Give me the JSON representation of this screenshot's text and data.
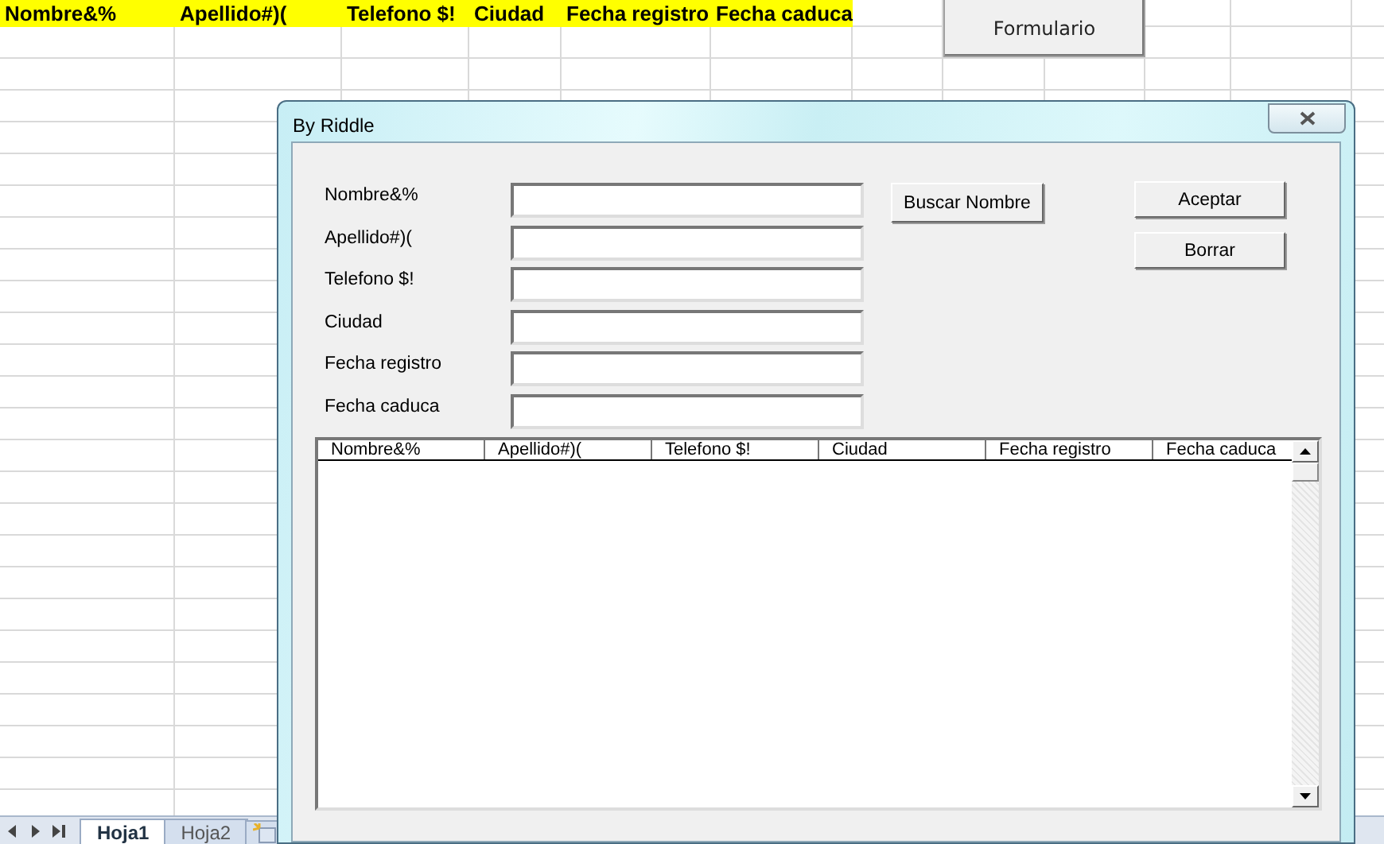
{
  "sheet": {
    "header_cells": [
      {
        "text": "Nombre&%",
        "highlighted": true
      },
      {
        "text": "Apellido#)(",
        "highlighted": true
      },
      {
        "text": "Telefono $!",
        "highlighted": true
      },
      {
        "text": "Ciudad",
        "highlighted": true
      },
      {
        "text": "Fecha registro",
        "highlighted": true
      },
      {
        "text": "Fecha caduca",
        "highlighted": true
      }
    ],
    "form_button": "Formulario",
    "tabs": [
      {
        "label": "Hoja1",
        "selected": true
      },
      {
        "label": "Hoja2",
        "selected": false
      }
    ]
  },
  "dialog": {
    "title": "By Riddle",
    "fields": [
      {
        "label": "Nombre&%"
      },
      {
        "label": "Apellido#)("
      },
      {
        "label": "Telefono $!"
      },
      {
        "label": "Ciudad"
      },
      {
        "label": "Fecha registro"
      },
      {
        "label": "Fecha caduca"
      }
    ],
    "search_button": "Buscar Nombre",
    "buttons": [
      "Aceptar",
      "Borrar"
    ],
    "list": {
      "columns": [
        "Nombre&%",
        "Apellido#)(",
        "Telefono $!",
        "Ciudad",
        "Fecha registro",
        "Fecha caduca"
      ]
    }
  }
}
